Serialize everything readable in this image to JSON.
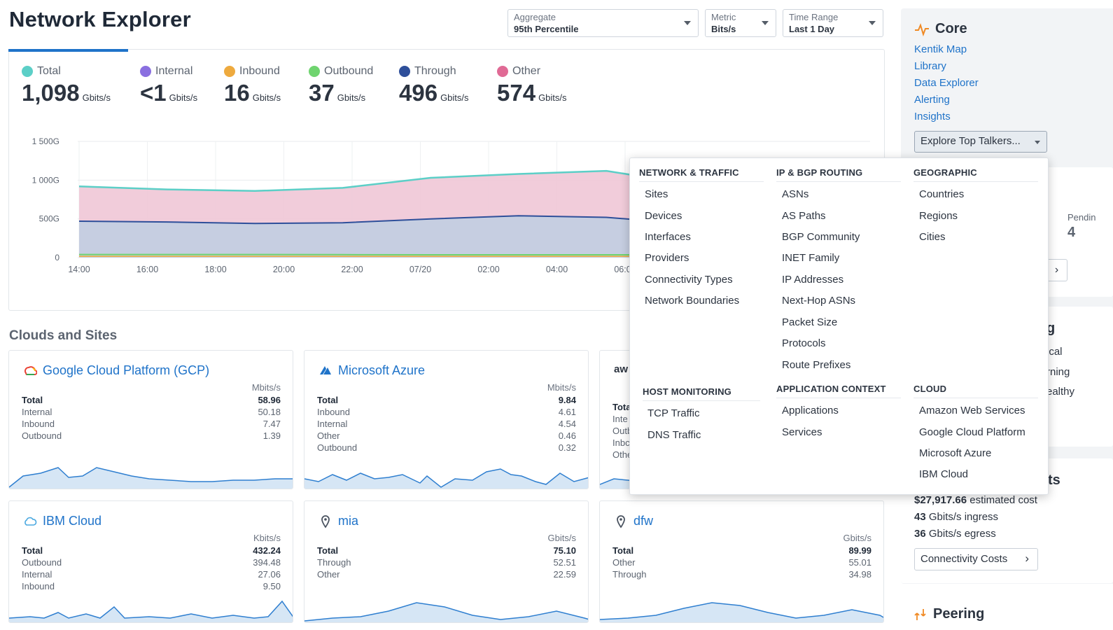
{
  "page": {
    "title": "Network Explorer"
  },
  "controls": {
    "aggregate": {
      "label": "Aggregate",
      "value": "95th Percentile"
    },
    "metric": {
      "label": "Metric",
      "value": "Bits/s"
    },
    "time_range": {
      "label": "Time Range",
      "value": "Last 1 Day"
    }
  },
  "stats": [
    {
      "label": "Total",
      "value": "1,098",
      "unit": "Gbits/s",
      "color": "#5ccfc7"
    },
    {
      "label": "Internal",
      "value": "<1",
      "unit": "Gbits/s",
      "color": "#8a6fe0"
    },
    {
      "label": "Inbound",
      "value": "16",
      "unit": "Gbits/s",
      "color": "#eeaa3e"
    },
    {
      "label": "Outbound",
      "value": "37",
      "unit": "Gbits/s",
      "color": "#6fd46f"
    },
    {
      "label": "Through",
      "value": "496",
      "unit": "Gbits/s",
      "color": "#2e4f9a"
    },
    {
      "label": "Other",
      "value": "574",
      "unit": "Gbits/s",
      "color": "#e06a95"
    }
  ],
  "chart_data": {
    "type": "area",
    "x": [
      "14:00",
      "16:00",
      "18:00",
      "20:00",
      "22:00",
      "07/20",
      "02:00",
      "04:00",
      "06:00"
    ],
    "y_ticks": [
      "1 500G",
      "1 000G",
      "500G",
      "0"
    ],
    "ylim": [
      0,
      1500
    ],
    "series": [
      {
        "name": "Total",
        "color": "#5ccfc7",
        "values": [
          920,
          880,
          860,
          900,
          1030,
          1080,
          1120,
          940,
          660,
          700
        ]
      },
      {
        "name": "Through",
        "color": "#2e4f9a",
        "values": [
          470,
          460,
          440,
          450,
          500,
          540,
          520,
          430,
          370,
          360
        ]
      },
      {
        "name": "Outbound",
        "color": "#6fd46f",
        "values": [
          40,
          40,
          40,
          38,
          36,
          36,
          36,
          36,
          36,
          36
        ]
      },
      {
        "name": "Inbound",
        "color": "#eeaa3e",
        "values": [
          16,
          16,
          16,
          16,
          16,
          16,
          16,
          16,
          16,
          16
        ]
      }
    ]
  },
  "clouds_section": {
    "title": "Clouds and Sites"
  },
  "cards": [
    {
      "title": "Google Cloud Platform (GCP)",
      "icon": "gcp-icon",
      "unit": "Mbits/s",
      "rows": [
        [
          "Total",
          "58.96"
        ],
        [
          "Internal",
          "50.18"
        ],
        [
          "Inbound",
          "7.47"
        ],
        [
          "Outbound",
          "1.39"
        ]
      ]
    },
    {
      "title": "Microsoft Azure",
      "icon": "azure-icon",
      "unit": "Mbits/s",
      "rows": [
        [
          "Total",
          "9.84"
        ],
        [
          "Inbound",
          "4.61"
        ],
        [
          "Internal",
          "4.54"
        ],
        [
          "Other",
          "0.46"
        ],
        [
          "Outbound",
          "0.32"
        ]
      ]
    },
    {
      "title": "aw",
      "icon": "aws-icon",
      "unit": "",
      "rows": [
        [
          "Tota",
          ""
        ],
        [
          "Inte",
          ""
        ],
        [
          "Outb",
          ""
        ],
        [
          "Inbc",
          ""
        ],
        [
          "Othe",
          ""
        ]
      ]
    },
    {
      "title": "IBM Cloud",
      "icon": "ibm-cloud-icon",
      "unit": "Kbits/s",
      "rows": [
        [
          "Total",
          "432.24"
        ],
        [
          "Outbound",
          "394.48"
        ],
        [
          "Internal",
          "27.06"
        ],
        [
          "Inbound",
          "9.50"
        ]
      ]
    },
    {
      "title": "mia",
      "icon": "location-pin-icon",
      "unit": "Gbits/s",
      "rows": [
        [
          "Total",
          "75.10"
        ],
        [
          "Through",
          "52.51"
        ],
        [
          "Other",
          "22.59"
        ]
      ]
    },
    {
      "title": "dfw",
      "icon": "location-pin-icon",
      "unit": "Gbits/s",
      "rows": [
        [
          "Total",
          "89.99"
        ],
        [
          "Other",
          "55.01"
        ],
        [
          "Through",
          "34.98"
        ]
      ]
    }
  ],
  "right_panel": {
    "core_title": "Core",
    "links": [
      "Kentik Map",
      "Library",
      "Data Explorer",
      "Alerting",
      "Insights"
    ],
    "explore_button": "Explore Top Talkers...",
    "pending_label": "Pendin",
    "pending_value": "4",
    "partial_title_1": "g",
    "partial_lines": [
      "ical",
      "rning",
      "ealthy"
    ],
    "partial_title_2": "ts",
    "cost_lines": [
      {
        "bold": "$27,917.66",
        "rest": " estimated cost"
      },
      {
        "bold": "43",
        "rest": " Gbits/s ingress"
      },
      {
        "bold": "36",
        "rest": " Gbits/s egress"
      }
    ],
    "costs_button": "Connectivity Costs",
    "peering_title": "Peering"
  },
  "dropdown": {
    "network_traffic": {
      "header": "NETWORK & TRAFFIC",
      "items": [
        "Sites",
        "Devices",
        "Interfaces",
        "Providers",
        "Connectivity Types",
        "Network Boundaries"
      ]
    },
    "ip_bgp": {
      "header": "IP & BGP ROUTING",
      "items": [
        "ASNs",
        "AS Paths",
        "BGP Community",
        "INET Family",
        "IP Addresses",
        "Next-Hop ASNs",
        "Packet Size",
        "Protocols",
        "Route Prefixes"
      ]
    },
    "geographic": {
      "header": "GEOGRAPHIC",
      "items": [
        "Countries",
        "Regions",
        "Cities"
      ]
    },
    "host_monitoring": {
      "header": "HOST MONITORING",
      "items": [
        "TCP Traffic",
        "DNS Traffic"
      ]
    },
    "app_context": {
      "header": "APPLICATION CONTEXT",
      "items": [
        "Applications",
        "Services"
      ]
    },
    "cloud": {
      "header": "CLOUD",
      "items": [
        "Amazon Web Services",
        "Google Cloud Platform",
        "Microsoft Azure",
        "IBM Cloud"
      ]
    }
  }
}
